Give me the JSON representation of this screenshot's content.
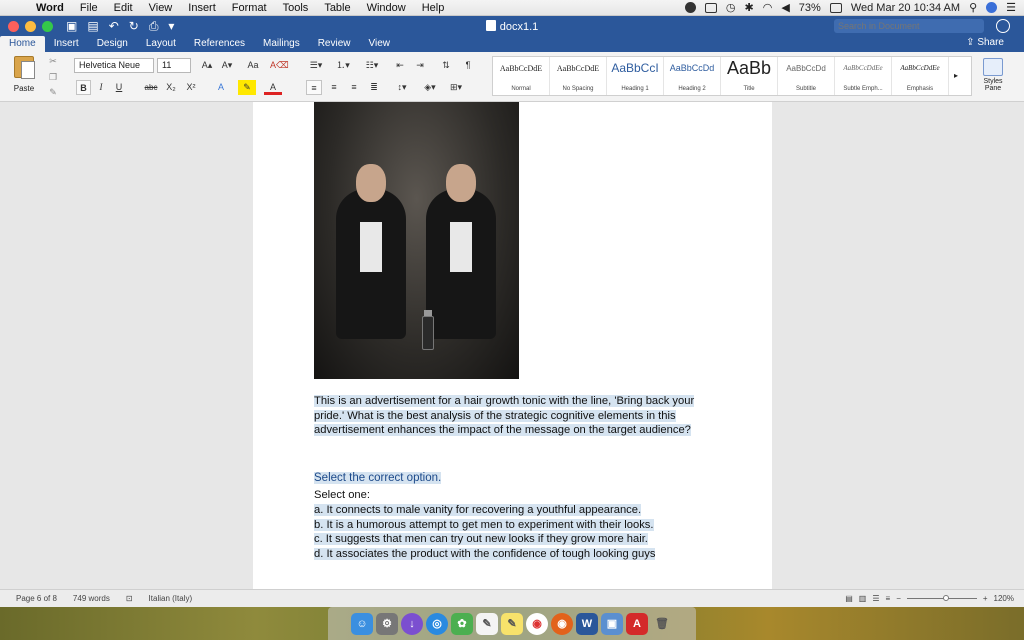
{
  "menubar": {
    "apple": "",
    "app_name": "Word",
    "items": [
      "File",
      "Edit",
      "View",
      "Insert",
      "Format",
      "Tools",
      "Table",
      "Window",
      "Help"
    ],
    "battery": "73%",
    "clock": "Wed Mar 20  10:34 AM"
  },
  "window": {
    "doc_title": "docx1.1",
    "search_placeholder": "Search in Document"
  },
  "ribbon": {
    "tabs": [
      "Home",
      "Insert",
      "Design",
      "Layout",
      "References",
      "Mailings",
      "Review",
      "View"
    ],
    "share_label": "Share",
    "paste_label": "Paste",
    "font_name": "Helvetica Neue",
    "font_size": "11",
    "bold": "B",
    "italic": "I",
    "underline": "U",
    "strike": "abc",
    "subscript": "X₂",
    "superscript": "X²",
    "styles": [
      {
        "sample": "AaBbCcDdE",
        "name": "Normal"
      },
      {
        "sample": "AaBbCcDdE",
        "name": "No Spacing"
      },
      {
        "sample": "AaBbCcI",
        "name": "Heading 1"
      },
      {
        "sample": "AaBbCcDd",
        "name": "Heading 2"
      },
      {
        "sample": "AaBb",
        "name": "Title"
      },
      {
        "sample": "AaBbCcDd",
        "name": "Subtitle"
      },
      {
        "sample": "AaBbCcDdEe",
        "name": "Subtle Emph..."
      },
      {
        "sample": "AaBbCcDdEe",
        "name": "Emphasis"
      }
    ],
    "styles_pane_label": "Styles Pane"
  },
  "document": {
    "question": "This is an advertisement for a hair growth tonic with the line, 'Bring back your pride.' What is the best analysis of the strategic cognitive elements in this advertisement enhances the impact of the message on the target audience?",
    "prompt": "Select the correct option.",
    "select_one": "Select one:",
    "options": [
      "a. It connects to male vanity for recovering a youthful appearance.",
      "b. It is a humorous attempt to get men to experiment with their looks.",
      "c. It suggests that men can try out new looks if they grow more hair.",
      "d. It associates the product with the confidence of tough looking guys"
    ]
  },
  "statusbar": {
    "page": "Page 6 of 8",
    "words": "749 words",
    "language": "Italian (Italy)",
    "zoom": "120%"
  },
  "colors": {
    "word_blue": "#2b579a",
    "highlight": "#d5e3f0"
  }
}
